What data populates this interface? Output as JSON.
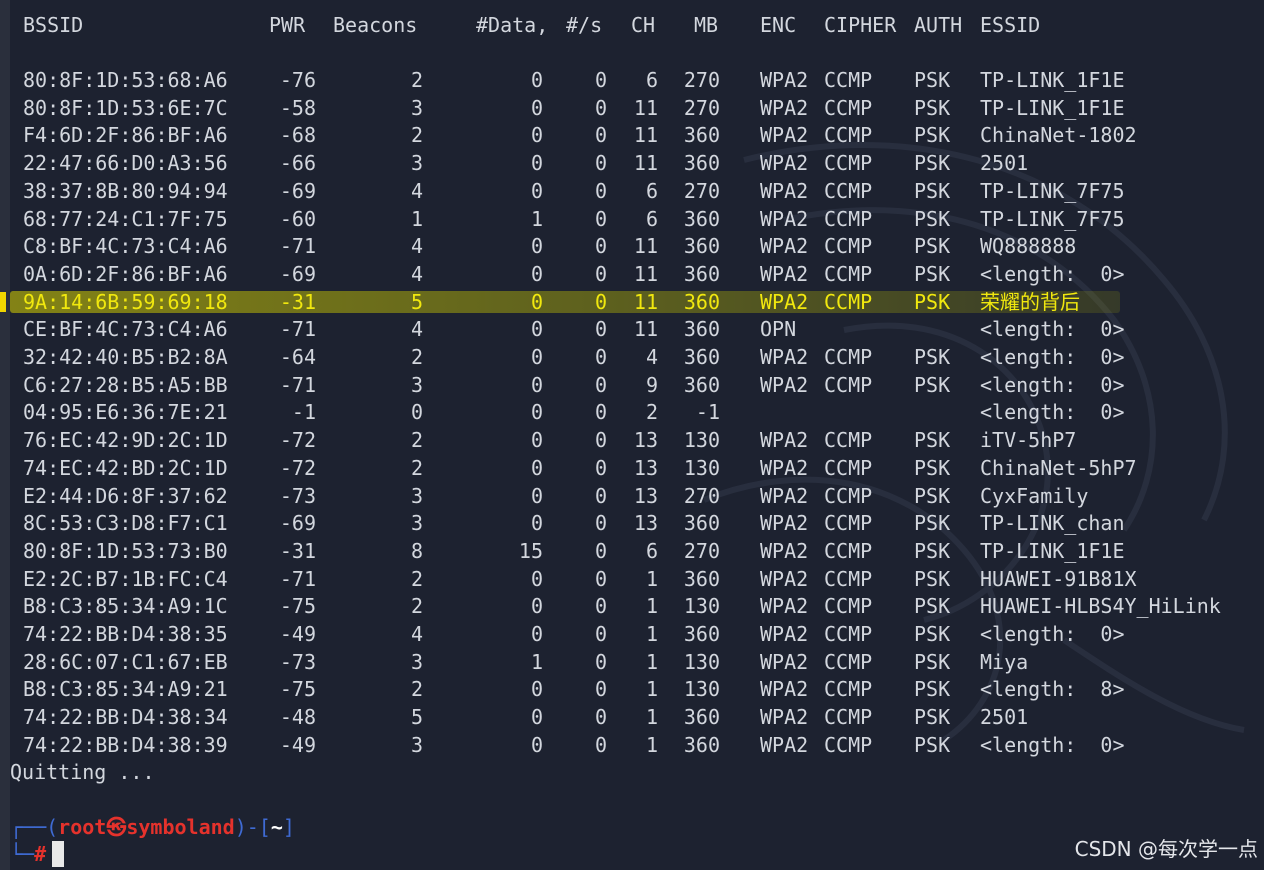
{
  "headers": {
    "bssid": "BSSID",
    "pwr": "PWR",
    "beacons": "Beacons",
    "data": "#Data,",
    "ps": "#/s",
    "ch": "CH",
    "mb": "MB",
    "enc": "ENC",
    "cipher": "CIPHER",
    "auth": "AUTH",
    "essid": "ESSID"
  },
  "rows": [
    {
      "bssid": "80:8F:1D:53:68:A6",
      "pwr": "-76",
      "beacons": "2",
      "data": "0",
      "ps": "0",
      "ch": "6",
      "mb": "270",
      "enc": "WPA2",
      "cipher": "CCMP",
      "auth": "PSK",
      "essid": "TP-LINK_1F1E"
    },
    {
      "bssid": "80:8F:1D:53:6E:7C",
      "pwr": "-58",
      "beacons": "3",
      "data": "0",
      "ps": "0",
      "ch": "11",
      "mb": "270",
      "enc": "WPA2",
      "cipher": "CCMP",
      "auth": "PSK",
      "essid": "TP-LINK_1F1E"
    },
    {
      "bssid": "F4:6D:2F:86:BF:A6",
      "pwr": "-68",
      "beacons": "2",
      "data": "0",
      "ps": "0",
      "ch": "11",
      "mb": "360",
      "enc": "WPA2",
      "cipher": "CCMP",
      "auth": "PSK",
      "essid": "ChinaNet-1802"
    },
    {
      "bssid": "22:47:66:D0:A3:56",
      "pwr": "-66",
      "beacons": "3",
      "data": "0",
      "ps": "0",
      "ch": "11",
      "mb": "360",
      "enc": "WPA2",
      "cipher": "CCMP",
      "auth": "PSK",
      "essid": "2501"
    },
    {
      "bssid": "38:37:8B:80:94:94",
      "pwr": "-69",
      "beacons": "4",
      "data": "0",
      "ps": "0",
      "ch": "6",
      "mb": "270",
      "enc": "WPA2",
      "cipher": "CCMP",
      "auth": "PSK",
      "essid": "TP-LINK_7F75"
    },
    {
      "bssid": "68:77:24:C1:7F:75",
      "pwr": "-60",
      "beacons": "1",
      "data": "1",
      "ps": "0",
      "ch": "6",
      "mb": "360",
      "enc": "WPA2",
      "cipher": "CCMP",
      "auth": "PSK",
      "essid": "TP-LINK_7F75"
    },
    {
      "bssid": "C8:BF:4C:73:C4:A6",
      "pwr": "-71",
      "beacons": "4",
      "data": "0",
      "ps": "0",
      "ch": "11",
      "mb": "360",
      "enc": "WPA2",
      "cipher": "CCMP",
      "auth": "PSK",
      "essid": "WQ888888"
    },
    {
      "bssid": "0A:6D:2F:86:BF:A6",
      "pwr": "-69",
      "beacons": "4",
      "data": "0",
      "ps": "0",
      "ch": "11",
      "mb": "360",
      "enc": "WPA2",
      "cipher": "CCMP",
      "auth": "PSK",
      "essid": "<length:  0>"
    },
    {
      "bssid": "9A:14:6B:59:69:18",
      "pwr": "-31",
      "beacons": "5",
      "data": "0",
      "ps": "0",
      "ch": "11",
      "mb": "360",
      "enc": "WPA2",
      "cipher": "CCMP",
      "auth": "PSK",
      "essid": "荣耀的背后"
    },
    {
      "bssid": "CE:BF:4C:73:C4:A6",
      "pwr": "-71",
      "beacons": "4",
      "data": "0",
      "ps": "0",
      "ch": "11",
      "mb": "360",
      "enc": "OPN",
      "cipher": "",
      "auth": "",
      "essid": "<length:  0>"
    },
    {
      "bssid": "32:42:40:B5:B2:8A",
      "pwr": "-64",
      "beacons": "2",
      "data": "0",
      "ps": "0",
      "ch": "4",
      "mb": "360",
      "enc": "WPA2",
      "cipher": "CCMP",
      "auth": "PSK",
      "essid": "<length:  0>"
    },
    {
      "bssid": "C6:27:28:B5:A5:BB",
      "pwr": "-71",
      "beacons": "3",
      "data": "0",
      "ps": "0",
      "ch": "9",
      "mb": "360",
      "enc": "WPA2",
      "cipher": "CCMP",
      "auth": "PSK",
      "essid": "<length:  0>"
    },
    {
      "bssid": "04:95:E6:36:7E:21",
      "pwr": "-1",
      "beacons": "0",
      "data": "0",
      "ps": "0",
      "ch": "2",
      "mb": "-1",
      "enc": "",
      "cipher": "",
      "auth": "",
      "essid": "<length:  0>"
    },
    {
      "bssid": "76:EC:42:9D:2C:1D",
      "pwr": "-72",
      "beacons": "2",
      "data": "0",
      "ps": "0",
      "ch": "13",
      "mb": "130",
      "enc": "WPA2",
      "cipher": "CCMP",
      "auth": "PSK",
      "essid": "iTV-5hP7"
    },
    {
      "bssid": "74:EC:42:BD:2C:1D",
      "pwr": "-72",
      "beacons": "2",
      "data": "0",
      "ps": "0",
      "ch": "13",
      "mb": "130",
      "enc": "WPA2",
      "cipher": "CCMP",
      "auth": "PSK",
      "essid": "ChinaNet-5hP7"
    },
    {
      "bssid": "E2:44:D6:8F:37:62",
      "pwr": "-73",
      "beacons": "3",
      "data": "0",
      "ps": "0",
      "ch": "13",
      "mb": "270",
      "enc": "WPA2",
      "cipher": "CCMP",
      "auth": "PSK",
      "essid": "CyxFamily"
    },
    {
      "bssid": "8C:53:C3:D8:F7:C1",
      "pwr": "-69",
      "beacons": "3",
      "data": "0",
      "ps": "0",
      "ch": "13",
      "mb": "360",
      "enc": "WPA2",
      "cipher": "CCMP",
      "auth": "PSK",
      "essid": "TP-LINK_chan"
    },
    {
      "bssid": "80:8F:1D:53:73:B0",
      "pwr": "-31",
      "beacons": "8",
      "data": "15",
      "ps": "0",
      "ch": "6",
      "mb": "270",
      "enc": "WPA2",
      "cipher": "CCMP",
      "auth": "PSK",
      "essid": "TP-LINK_1F1E"
    },
    {
      "bssid": "E2:2C:B7:1B:FC:C4",
      "pwr": "-71",
      "beacons": "2",
      "data": "0",
      "ps": "0",
      "ch": "1",
      "mb": "360",
      "enc": "WPA2",
      "cipher": "CCMP",
      "auth": "PSK",
      "essid": "HUAWEI-91B81X"
    },
    {
      "bssid": "B8:C3:85:34:A9:1C",
      "pwr": "-75",
      "beacons": "2",
      "data": "0",
      "ps": "0",
      "ch": "1",
      "mb": "130",
      "enc": "WPA2",
      "cipher": "CCMP",
      "auth": "PSK",
      "essid": "HUAWEI-HLBS4Y_HiLink"
    },
    {
      "bssid": "74:22:BB:D4:38:35",
      "pwr": "-49",
      "beacons": "4",
      "data": "0",
      "ps": "0",
      "ch": "1",
      "mb": "360",
      "enc": "WPA2",
      "cipher": "CCMP",
      "auth": "PSK",
      "essid": "<length:  0>"
    },
    {
      "bssid": "28:6C:07:C1:67:EB",
      "pwr": "-73",
      "beacons": "3",
      "data": "1",
      "ps": "0",
      "ch": "1",
      "mb": "130",
      "enc": "WPA2",
      "cipher": "CCMP",
      "auth": "PSK",
      "essid": "Miya"
    },
    {
      "bssid": "B8:C3:85:34:A9:21",
      "pwr": "-75",
      "beacons": "2",
      "data": "0",
      "ps": "0",
      "ch": "1",
      "mb": "130",
      "enc": "WPA2",
      "cipher": "CCMP",
      "auth": "PSK",
      "essid": "<length:  8>"
    },
    {
      "bssid": "74:22:BB:D4:38:34",
      "pwr": "-48",
      "beacons": "5",
      "data": "0",
      "ps": "0",
      "ch": "1",
      "mb": "360",
      "enc": "WPA2",
      "cipher": "CCMP",
      "auth": "PSK",
      "essid": "2501"
    },
    {
      "bssid": "74:22:BB:D4:38:39",
      "pwr": "-49",
      "beacons": "3",
      "data": "0",
      "ps": "0",
      "ch": "1",
      "mb": "360",
      "enc": "WPA2",
      "cipher": "CCMP",
      "auth": "PSK",
      "essid": "<length:  0>"
    }
  ],
  "highlighted_row": 8,
  "quit_text": "Quitting ...",
  "prompt": {
    "user": "root",
    "at_symbol": "㉿",
    "host": "symboland",
    "dir": "~",
    "hash": "#"
  },
  "watermark": "CSDN @每次学一点",
  "colors": {
    "background": "#1d2230",
    "text": "#d3d7de",
    "highlight": "#f1e80e",
    "prompt_box": "#3f6bd4",
    "prompt_user": "#e5322c"
  }
}
